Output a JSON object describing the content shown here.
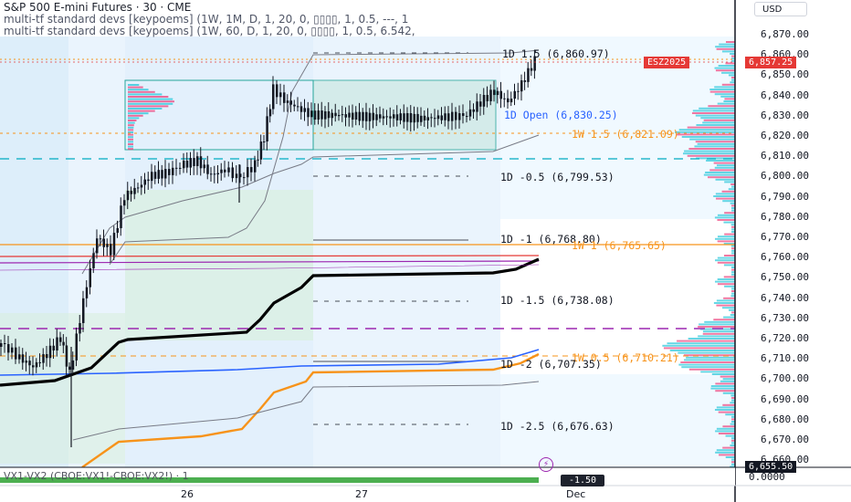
{
  "header": {
    "title": "S&P 500 E-mini Futures · 30 · CME",
    "indicator_1": "multi-tf standard devs [keypoems] (1W, 1M, D, 1, 20, 0, ▯▯▯▯, 1, 0.5, ---, 1",
    "indicator_2": "multi-tf standard devs [keypoems] (1W, 60, D, 1, 20, 0, ▯▯▯▯, 1, 0.5, 6.542,"
  },
  "price_axis": {
    "currency": "USD",
    "ticks": [
      "6,870.00",
      "6,860.00",
      "6,850.00",
      "6,840.00",
      "6,830.00",
      "6,820.00",
      "6,810.00",
      "6,800.00",
      "6,790.00",
      "6,780.00",
      "6,770.00",
      "6,760.00",
      "6,750.00",
      "6,740.00",
      "6,730.00",
      "6,720.00",
      "6,710.00",
      "6,700.00",
      "6,690.00",
      "6,680.00",
      "6,670.00",
      "6,660.00"
    ],
    "symbol_tag": "ESZ2025",
    "last_price": "6,857.25",
    "bottom_price": "6,655.50"
  },
  "levels": [
    {
      "label": "1D 1.5 (6,860.97)",
      "color": "#131722"
    },
    {
      "label": "1D Open (6,830.25)",
      "color": "#2962ff"
    },
    {
      "label": "1W 1.5 (6,821.09)",
      "color": "#f7931a"
    },
    {
      "label": "1D -0.5 (6,799.53)",
      "color": "#131722"
    },
    {
      "label": "1D -1 (6,768.80)",
      "color": "#131722"
    },
    {
      "label": "1W 1 (6,765.65)",
      "color": "#f7931a"
    },
    {
      "label": "1D -1.5 (6,738.08)",
      "color": "#131722"
    },
    {
      "label": "1W 0.5 (6,710.21)",
      "color": "#f7931a"
    },
    {
      "label": "1D -2 (6,707.35)",
      "color": "#131722"
    },
    {
      "label": "1D -2.5 (6,676.63)",
      "color": "#131722"
    }
  ],
  "time_axis": {
    "labels": [
      "26",
      "27",
      "Dec"
    ]
  },
  "subpane": {
    "label": "VX1-VX2 (CBOE:VX1!-CBOE:VX2!) · 1",
    "value_tag": "-1.50",
    "axis_value": "0.0000"
  },
  "colors": {
    "up": "#131722",
    "down": "#131722",
    "orange": "#f7931a",
    "blue": "#2962ff",
    "purple": "#9c27b0",
    "red": "#e53935",
    "teal": "#26a69a",
    "pink": "#ec407a",
    "cyan": "#26c6da"
  }
}
